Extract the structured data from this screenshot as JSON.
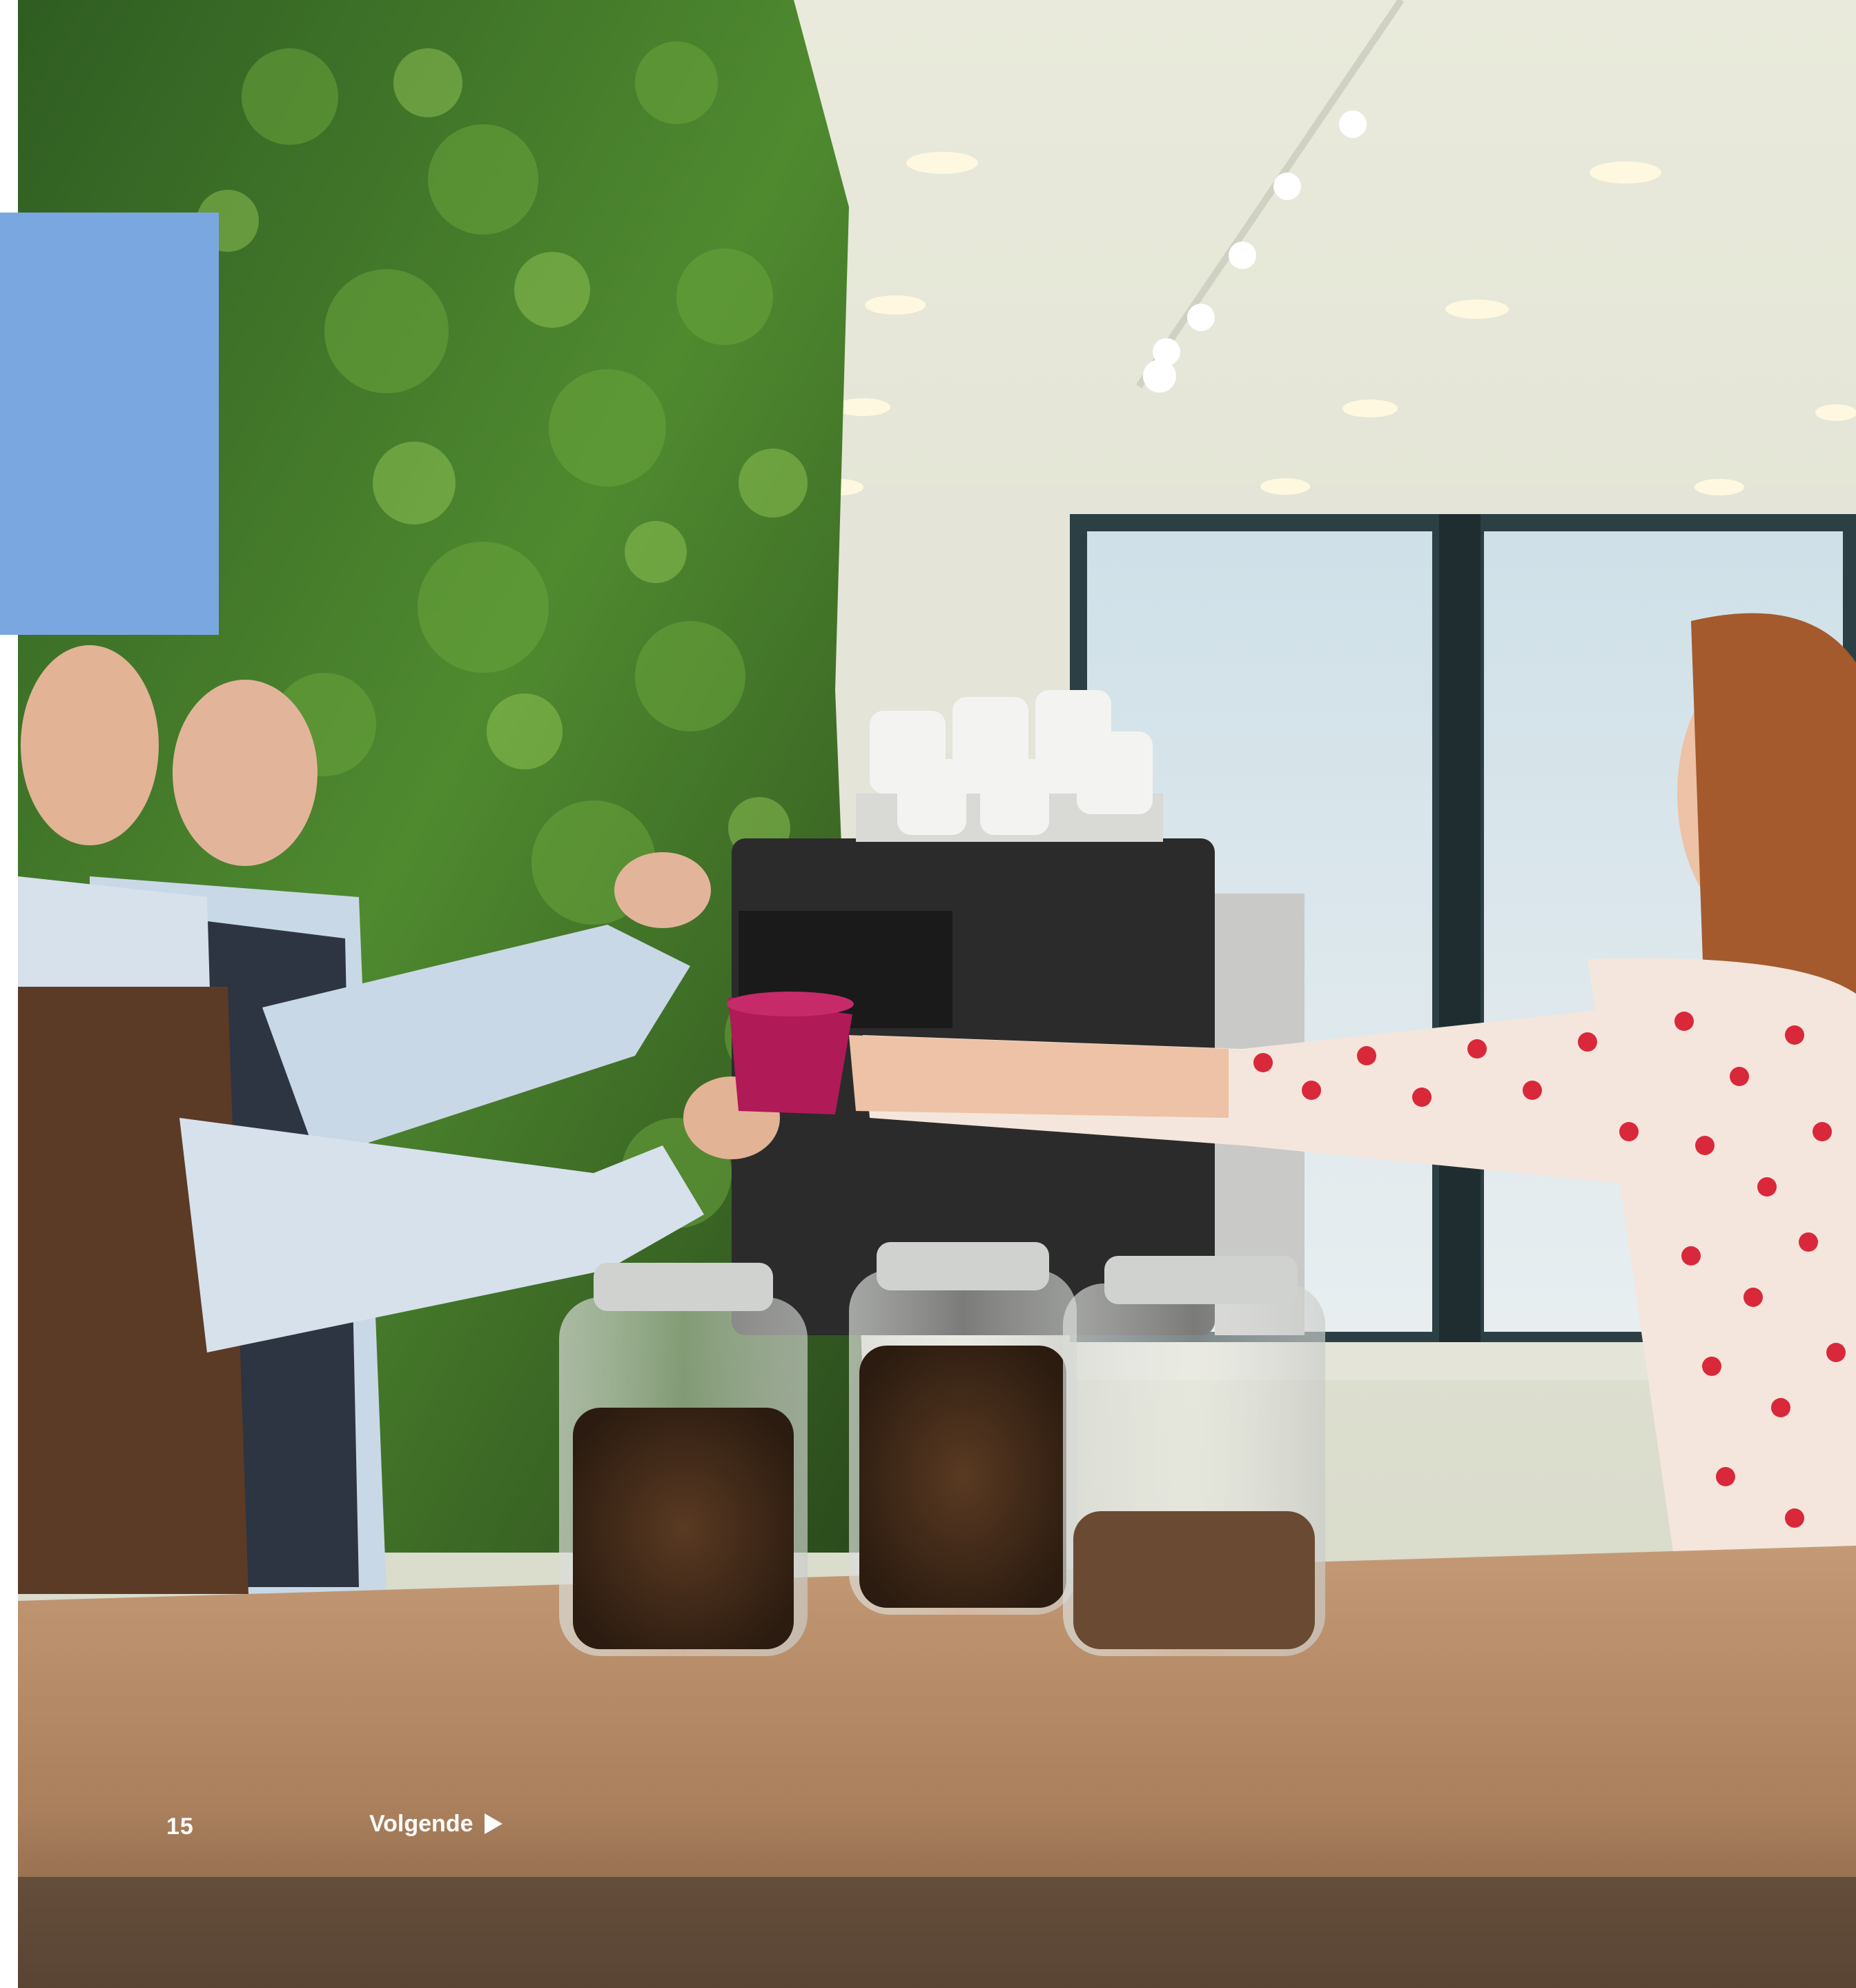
{
  "page": {
    "number": "15",
    "next_label": "Volgende"
  },
  "colors": {
    "accent": "#7ba7e0",
    "text": "#ffffff"
  },
  "icons": {
    "next": "play-triangle-icon"
  }
}
